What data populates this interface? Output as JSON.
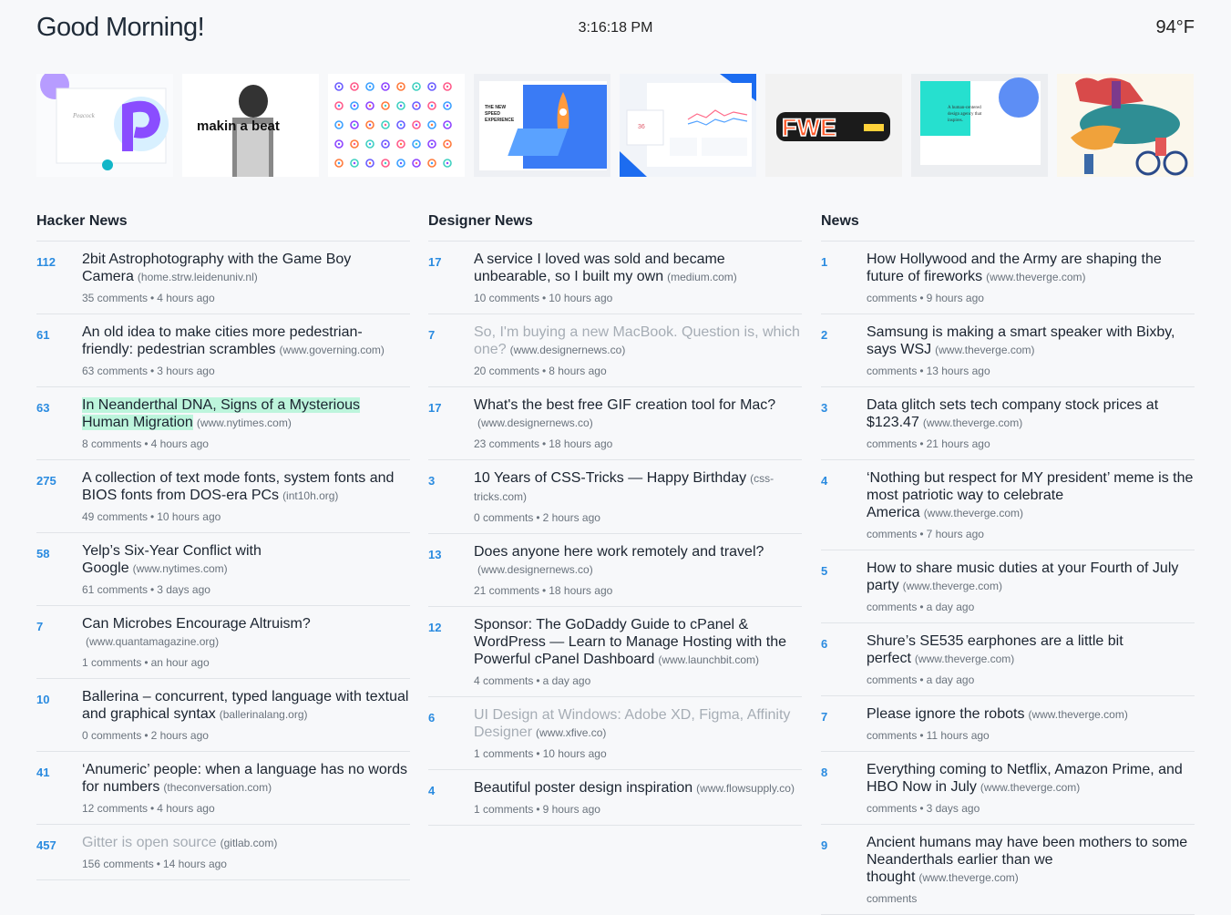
{
  "header": {
    "greeting": "Good Morning!",
    "time": "3:16:18 PM",
    "temperature": "94°F"
  },
  "thumbnails": [
    {
      "icon": "peacock-app-mockup"
    },
    {
      "icon": "makin-a-beat-portrait",
      "text": "makin a beat"
    },
    {
      "icon": "icon-set-grid"
    },
    {
      "icon": "rocket-phone-illustration",
      "text": "THE NEW SPEED EXPERIENCE"
    },
    {
      "icon": "dashboard-ui"
    },
    {
      "icon": "fwe-logo",
      "text": "FWE"
    },
    {
      "icon": "agency-landing-page",
      "text": "A human-centered design agency that inspires."
    },
    {
      "icon": "bicycle-illustration"
    }
  ],
  "columns": [
    {
      "title": "Hacker News",
      "stories": [
        {
          "rank": "112",
          "title": "2bit Astrophotography with the Game Boy Camera",
          "domain": "(home.strw.leidenuniv.nl)",
          "comments": "35 comments",
          "time": "4 hours ago",
          "visited": false,
          "highlight": false
        },
        {
          "rank": "61",
          "title": "An old idea to make cities more pedestrian-friendly: pedestrian scrambles",
          "domain": "(www.governing.com)",
          "comments": "63 comments",
          "time": "3 hours ago",
          "visited": false,
          "highlight": false
        },
        {
          "rank": "63",
          "title": "In Neanderthal DNA, Signs of a Mysterious Human Migration",
          "domain": "(www.nytimes.com)",
          "comments": "8 comments",
          "time": "4 hours ago",
          "visited": false,
          "highlight": true
        },
        {
          "rank": "275",
          "title": "A collection of text mode fonts, system fonts and BIOS fonts from DOS-era PCs",
          "domain": "(int10h.org)",
          "comments": "49 comments",
          "time": "10 hours ago",
          "visited": false,
          "highlight": false
        },
        {
          "rank": "58",
          "title": "Yelp’s Six-Year Conflict with Google",
          "domain": "(www.nytimes.com)",
          "comments": "61 comments",
          "time": "3 days ago",
          "visited": false,
          "highlight": false
        },
        {
          "rank": "7",
          "title": "Can Microbes Encourage Altruism?",
          "domain": "(www.quantamagazine.org)",
          "comments": "1 comments",
          "time": "an hour ago",
          "visited": false,
          "highlight": false
        },
        {
          "rank": "10",
          "title": "Ballerina – concurrent, typed language with textual and graphical syntax",
          "domain": "(ballerinalang.org)",
          "comments": "0 comments",
          "time": "2 hours ago",
          "visited": false,
          "highlight": false
        },
        {
          "rank": "41",
          "title": "‘Anumeric’ people: when a language has no words for numbers",
          "domain": "(theconversation.com)",
          "comments": "12 comments",
          "time": "4 hours ago",
          "visited": false,
          "highlight": false
        },
        {
          "rank": "457",
          "title": "Gitter is open source",
          "domain": "(gitlab.com)",
          "comments": "156 comments",
          "time": "14 hours ago",
          "visited": true,
          "highlight": false
        }
      ]
    },
    {
      "title": "Designer News",
      "stories": [
        {
          "rank": "17",
          "title": "A service I loved was sold and became unbearable, so I built my own",
          "domain": "(medium.com)",
          "comments": "10 comments",
          "time": "10 hours ago",
          "visited": false,
          "highlight": false
        },
        {
          "rank": "7",
          "title": "So, I'm buying a new MacBook. Question is, which one?",
          "domain": "(www.designernews.co)",
          "comments": "20 comments",
          "time": "8 hours ago",
          "visited": true,
          "highlight": false
        },
        {
          "rank": "17",
          "title": "What's the best free GIF creation tool for Mac?",
          "domain": "(www.designernews.co)",
          "comments": "23 comments",
          "time": "18 hours ago",
          "visited": false,
          "highlight": false
        },
        {
          "rank": "3",
          "title": "10 Years of CSS-Tricks — Happy Birthday",
          "domain": "(css-tricks.com)",
          "comments": "0 comments",
          "time": "2 hours ago",
          "visited": false,
          "highlight": false
        },
        {
          "rank": "13",
          "title": "Does anyone here work remotely and travel?",
          "domain": "(www.designernews.co)",
          "comments": "21 comments",
          "time": "18 hours ago",
          "visited": false,
          "highlight": false
        },
        {
          "rank": "12",
          "title": "Sponsor: The GoDaddy Guide to cPanel & WordPress — Learn to Manage Hosting with the Powerful cPanel Dashboard",
          "domain": "(www.launchbit.com)",
          "comments": "4 comments",
          "time": "a day ago",
          "visited": false,
          "highlight": false
        },
        {
          "rank": "6",
          "title": "UI Design at Windows: Adobe XD, Figma, Affinity Designer",
          "domain": "(www.xfive.co)",
          "comments": "1 comments",
          "time": "10 hours ago",
          "visited": true,
          "highlight": false
        },
        {
          "rank": "4",
          "title": "Beautiful poster design inspiration",
          "domain": "(www.flowsupply.co)",
          "comments": "1 comments",
          "time": "9 hours ago",
          "visited": false,
          "highlight": false
        }
      ]
    },
    {
      "title": "News",
      "stories": [
        {
          "rank": "1",
          "title": "How Hollywood and the Army are shaping the future of fireworks",
          "domain": "(www.theverge.com)",
          "comments": "comments",
          "time": "9 hours ago",
          "visited": false,
          "highlight": false
        },
        {
          "rank": "2",
          "title": "Samsung is making a smart speaker with Bixby, says WSJ",
          "domain": "(www.theverge.com)",
          "comments": "comments",
          "time": "13 hours ago",
          "visited": false,
          "highlight": false
        },
        {
          "rank": "3",
          "title": "Data glitch sets tech company stock prices at $123.47",
          "domain": "(www.theverge.com)",
          "comments": "comments",
          "time": "21 hours ago",
          "visited": false,
          "highlight": false
        },
        {
          "rank": "4",
          "title": "‘Nothing but respect for MY president’ meme is the most patriotic way to celebrate America",
          "domain": "(www.theverge.com)",
          "comments": "comments",
          "time": "7 hours ago",
          "visited": false,
          "highlight": false
        },
        {
          "rank": "5",
          "title": "How to share music duties at your Fourth of July party",
          "domain": "(www.theverge.com)",
          "comments": "comments",
          "time": "a day ago",
          "visited": false,
          "highlight": false
        },
        {
          "rank": "6",
          "title": "Shure’s SE535 earphones are a little bit perfect",
          "domain": "(www.theverge.com)",
          "comments": "comments",
          "time": "a day ago",
          "visited": false,
          "highlight": false
        },
        {
          "rank": "7",
          "title": "Please ignore the robots",
          "domain": "(www.theverge.com)",
          "comments": "comments",
          "time": "11 hours ago",
          "visited": false,
          "highlight": false
        },
        {
          "rank": "8",
          "title": "Everything coming to Netflix, Amazon Prime, and HBO Now in July",
          "domain": "(www.theverge.com)",
          "comments": "comments",
          "time": "3 days ago",
          "visited": false,
          "highlight": false
        },
        {
          "rank": "9",
          "title": "Ancient humans may have been mothers to some Neanderthals earlier than we thought",
          "domain": "(www.theverge.com)",
          "comments": "comments",
          "time": "",
          "visited": false,
          "highlight": false
        }
      ]
    }
  ]
}
